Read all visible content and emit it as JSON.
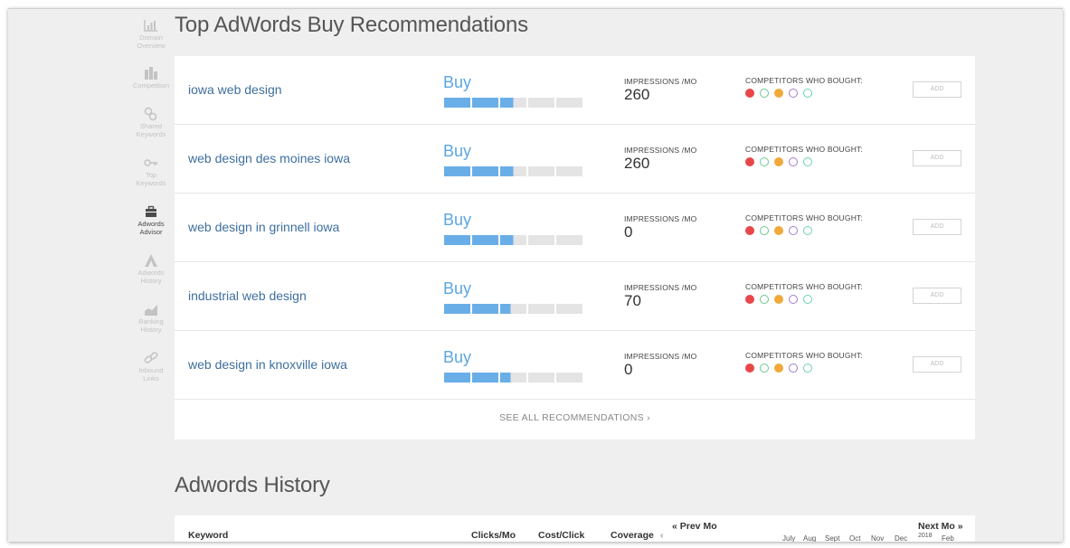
{
  "sidebar": {
    "items": [
      {
        "label_1": "Domain",
        "label_2": "Overview",
        "icon": "bar-chart-icon",
        "active": false
      },
      {
        "label_1": "Competition",
        "label_2": "",
        "icon": "competition-icon",
        "active": false
      },
      {
        "label_1": "Shared",
        "label_2": "Keywords",
        "icon": "link-icon",
        "active": false
      },
      {
        "label_1": "Top",
        "label_2": "Keywords",
        "icon": "key-icon",
        "active": false
      },
      {
        "label_1": "Adwords",
        "label_2": "Advisor",
        "icon": "briefcase-icon",
        "active": true
      },
      {
        "label_1": "Adwords",
        "label_2": "History",
        "icon": "adwords-icon",
        "active": false
      },
      {
        "label_1": "Ranking",
        "label_2": "History",
        "icon": "area-chart-icon",
        "active": false
      },
      {
        "label_1": "Inbound",
        "label_2": "Links",
        "icon": "chain-icon",
        "active": false
      }
    ]
  },
  "recommendations": {
    "title": "Top AdWords Buy Recommendations",
    "impressions_label": "IMPRESSIONS /MO",
    "competitors_label": "COMPETITORS WHO BOUGHT:",
    "add_label": "ADD",
    "see_all_label": "SEE ALL RECOMMENDATIONS ›",
    "dot_colors": [
      "#e8474a",
      "#6bc88e",
      "#f0a93a",
      "#a37ad0",
      "#6ad0b0"
    ],
    "dot_filled": [
      true,
      false,
      true,
      false,
      false
    ],
    "rows": [
      {
        "keyword": "iowa web design",
        "action": "Buy",
        "strength": 0.5,
        "impressions": "260"
      },
      {
        "keyword": "web design des moines iowa",
        "action": "Buy",
        "strength": 0.5,
        "impressions": "260"
      },
      {
        "keyword": "web design in grinnell iowa",
        "action": "Buy",
        "strength": 0.5,
        "impressions": "0"
      },
      {
        "keyword": "industrial web design",
        "action": "Buy",
        "strength": 0.48,
        "impressions": "70"
      },
      {
        "keyword": "web design in knoxville iowa",
        "action": "Buy",
        "strength": 0.48,
        "impressions": "0"
      }
    ]
  },
  "history": {
    "title": "Adwords History",
    "columns": {
      "keyword": "Keyword",
      "clicks": "Clicks/Mo",
      "cost": "Cost/Click",
      "coverage": "Coverage"
    },
    "prev_label": "« Prev Mo",
    "next_label": "Next Mo »",
    "prev_arrow": "‹",
    "year_label": "2018",
    "months": [
      "July",
      "Aug",
      "Sept",
      "Oct",
      "Nov",
      "Dec",
      "Feb"
    ]
  },
  "colors": {
    "accent": "#5ba6e3",
    "link": "#3e6f9e",
    "bar_on": "#6aaee8",
    "bar_off": "#e4e4e4"
  }
}
